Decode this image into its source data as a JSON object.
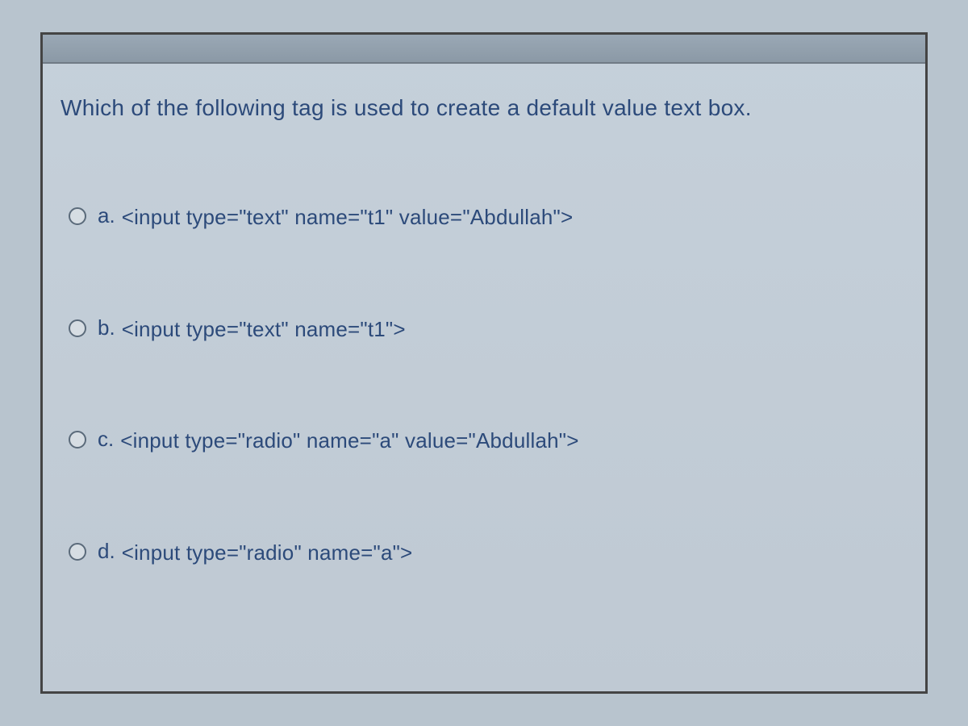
{
  "question": "Which of the following tag is used to create a default value text box.",
  "options": [
    {
      "letter": "a.",
      "code": "<input type=\"text\" name=\"t1\" value=\"Abdullah\">"
    },
    {
      "letter": "b.",
      "code": "<input type=\"text\" name=\"t1\">"
    },
    {
      "letter": "c.",
      "code": "<input type=\"radio\" name=\"a\" value=\"Abdullah\">"
    },
    {
      "letter": "d.",
      "code": "<input type=\"radio\" name=\"a\">"
    }
  ]
}
